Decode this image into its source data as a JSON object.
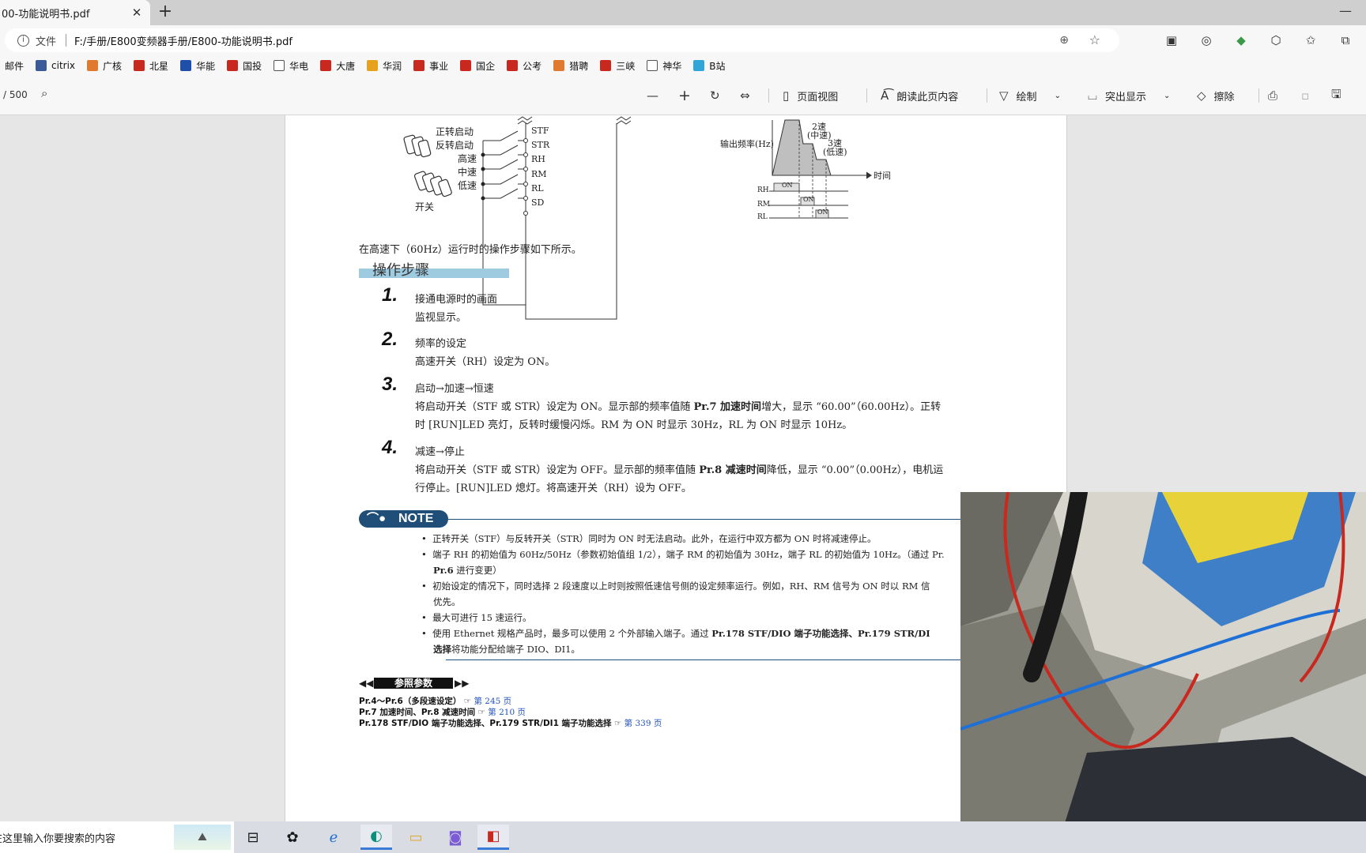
{
  "browser": {
    "tab_title": "00-功能说明书.pdf",
    "tab_close": "✕",
    "new_tab": "+",
    "minimize": "—",
    "file_label": "文件",
    "url": "F:/手册/E800变频器手册/E800-功能说明书.pdf"
  },
  "bookmarks": [
    {
      "label": "邮件",
      "color": ""
    },
    {
      "label": "citrix",
      "color": "#3a5a99"
    },
    {
      "label": "广核",
      "color": "#e07a2e"
    },
    {
      "label": "北星",
      "color": "#c9281e"
    },
    {
      "label": "华能",
      "color": "#1f4fa8"
    },
    {
      "label": "国投",
      "color": "#c9281e"
    },
    {
      "label": "华电",
      "color": ""
    },
    {
      "label": "大唐",
      "color": "#c9281e"
    },
    {
      "label": "华润",
      "color": "#e6a21d"
    },
    {
      "label": "事业",
      "color": "#c9281e"
    },
    {
      "label": "国企",
      "color": "#c9281e"
    },
    {
      "label": "公考",
      "color": "#c9281e"
    },
    {
      "label": "猎聘",
      "color": "#e07a2e"
    },
    {
      "label": "三峡",
      "color": "#c9281e"
    },
    {
      "label": "神华",
      "color": ""
    },
    {
      "label": "B站",
      "color": "#2fa5d8"
    }
  ],
  "pdf_toolbar": {
    "page_count": "/ 500",
    "page_view": "页面视图",
    "read_aloud": "朗读此页内容",
    "draw": "绘制",
    "highlight": "突出显示",
    "erase": "擦除"
  },
  "document": {
    "switch_labels": [
      "正转启动",
      "反转启动",
      "高速",
      "中速",
      "低速"
    ],
    "switch_caption": "开关",
    "terminals": [
      "STF",
      "STR",
      "RH",
      "RM",
      "RL",
      "SD"
    ],
    "timing": {
      "ylabel": "输出频率(Hz)",
      "xlabel": "时间",
      "speed2": "2速",
      "speed2_sub": "(中速)",
      "speed3": "3速",
      "speed3_sub": "(低速)",
      "signals": [
        "RH",
        "RM",
        "RL"
      ],
      "on_label": "ON"
    },
    "intro": "在高速下（60Hz）运行时的操作步骤如下所示。",
    "section_title": "操作步骤",
    "steps": [
      {
        "num": "1.",
        "title": "接通电源时的画面",
        "lines": [
          "监视显示。"
        ]
      },
      {
        "num": "2.",
        "title": "频率的设定",
        "lines": [
          "高速开关（RH）设定为 ON。"
        ]
      },
      {
        "num": "3.",
        "title": "启动→加速→恒速",
        "l1a": "将启动开关（STF 或 STR）设定为 ON。显示部的频率值随 ",
        "l1b": "Pr.7 加速时间",
        "l1c": "增大，显示 “60.00”（60.00Hz）。正转",
        "l2": "时 [RUN]LED 亮灯，反转时缓慢闪烁。RM 为 ON 时显示 30Hz，RL 为 ON 时显示 10Hz。"
      },
      {
        "num": "4.",
        "title": "减速→停止",
        "l1a": "将启动开关（STF 或 STR）设定为 OFF。显示部的频率值随 ",
        "l1b": "Pr.8 减速时间",
        "l1c": "降低，显示 “0.00”（0.00Hz），电机运",
        "l2": "行停止。[RUN]LED 熄灯。将高速开关（RH）设为 OFF。"
      }
    ],
    "note_label": "NOTE",
    "notes": {
      "n1": "正转开关（STF）与反转开关（STR）同时为 ON 时无法启动。此外，在运行中双方都为 ON 时将减速停止。",
      "n2": "端子 RH 的初始值为 60Hz/50Hz（参数初始值组 1/2），端子 RM 的初始值为 30Hz，端子 RL 的初始值为 10Hz。（通过 Pr.",
      "n2b": "Pr.6",
      "n2c": " 进行变更）",
      "n3": "初始设定的情况下，同时选择 2 段速度以上时则按照低速信号侧的设定频率运行。例如，RH、RM 信号为 ON 时以 RM 信",
      "n3b": "优先。",
      "n4": "最大可进行 15 速运行。",
      "n5a": "使用 Ethernet 规格产品时，最多可以使用 2 个外部输入端子。通过 ",
      "n5b": "Pr.178 STF/DIO 端子功能选择、Pr.179 STR/DI",
      "n5c": "选择",
      "n5d": "将功能分配给端子 DIO、DI1。"
    },
    "ref_title": "参照参数",
    "refs": [
      {
        "text": "Pr.4～Pr.6（多段速设定）",
        "link": "第 245 页"
      },
      {
        "text": "Pr.7 加速时间、Pr.8 减速时间",
        "link": "第 210 页"
      },
      {
        "text": "Pr.178 STF/DIO 端子功能选择、Pr.179 STR/DI1 端子功能选择",
        "link": "第 339 页"
      }
    ]
  },
  "taskbar": {
    "search_placeholder": "在这里输入你要搜索的内容"
  }
}
